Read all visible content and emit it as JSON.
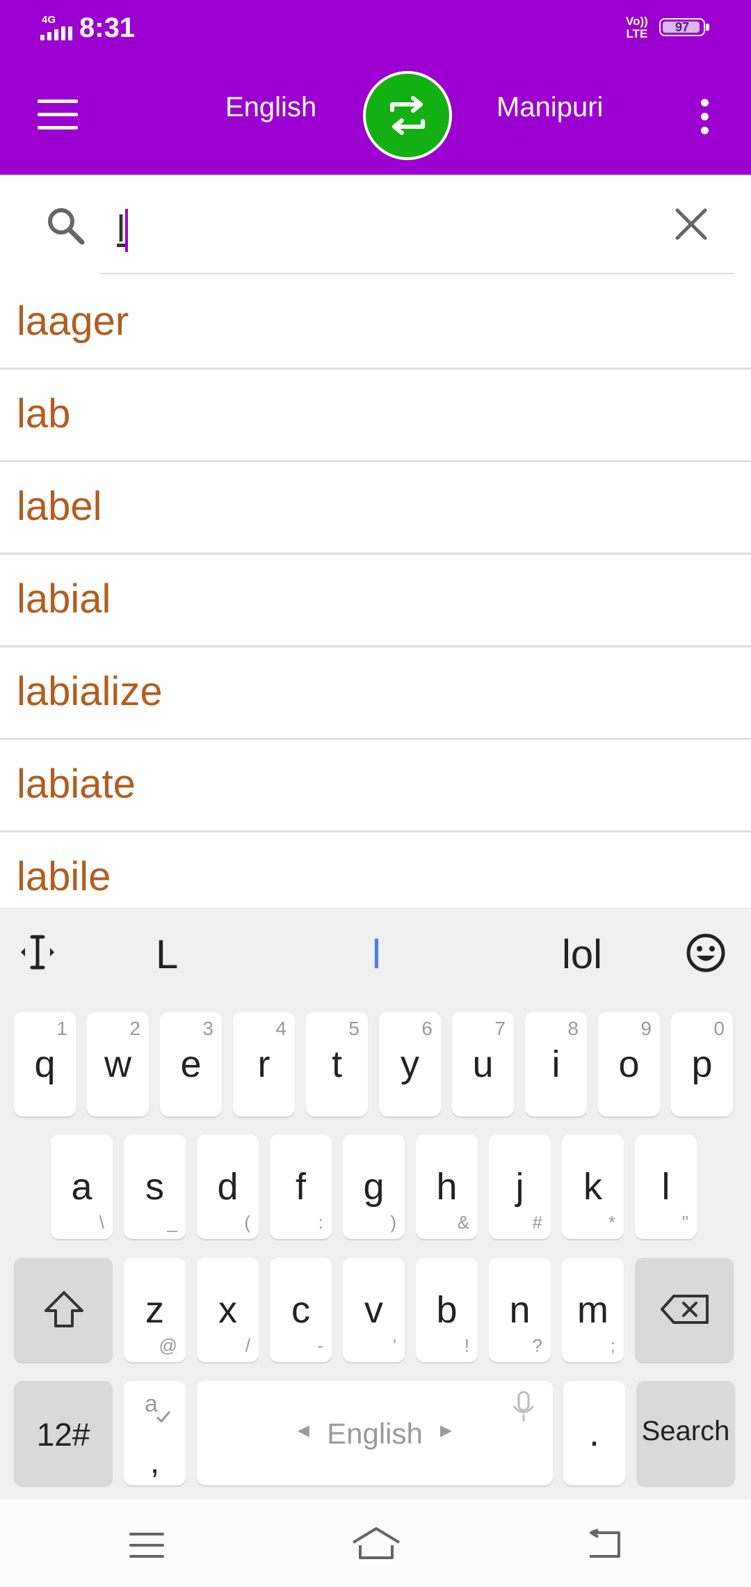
{
  "status_bar": {
    "network": "4G",
    "time": "8:31",
    "volte_top": "Vo))",
    "volte_bottom": "LTE",
    "battery": "97"
  },
  "app_bar": {
    "source_language": "English",
    "target_language": "Manipuri"
  },
  "search": {
    "value": "l"
  },
  "suggestions": [
    "laager",
    "lab",
    "label",
    "labial",
    "labialize",
    "labiate",
    "labile"
  ],
  "keyboard": {
    "suggestions": [
      "L",
      "l",
      "lol"
    ],
    "rows": [
      [
        {
          "k": "q",
          "hint": "1"
        },
        {
          "k": "w",
          "hint": "2"
        },
        {
          "k": "e",
          "hint": "3"
        },
        {
          "k": "r",
          "hint": "4"
        },
        {
          "k": "t",
          "hint": "5"
        },
        {
          "k": "y",
          "hint": "6"
        },
        {
          "k": "u",
          "hint": "7"
        },
        {
          "k": "i",
          "hint": "8"
        },
        {
          "k": "o",
          "hint": "9"
        },
        {
          "k": "p",
          "hint": "0"
        }
      ],
      [
        {
          "k": "a",
          "sub": "\\"
        },
        {
          "k": "s",
          "sub": "_"
        },
        {
          "k": "d",
          "sub": "("
        },
        {
          "k": "f",
          "sub": ":"
        },
        {
          "k": "g",
          "sub": ")"
        },
        {
          "k": "h",
          "sub": "&"
        },
        {
          "k": "j",
          "sub": "#"
        },
        {
          "k": "k",
          "sub": "*"
        },
        {
          "k": "l",
          "sub": "\""
        }
      ],
      [
        {
          "k": "z",
          "sub": "@"
        },
        {
          "k": "x",
          "sub": "/"
        },
        {
          "k": "c",
          "sub": "-"
        },
        {
          "k": "v",
          "sub": "'"
        },
        {
          "k": "b",
          "sub": "!"
        },
        {
          "k": "n",
          "sub": "?"
        },
        {
          "k": "m",
          "sub": ";"
        }
      ]
    ],
    "numbers_key": "12#",
    "comma_key": ",",
    "space_language": "English",
    "period_key": ".",
    "action_key": "Search"
  },
  "colors": {
    "app_bar": "#9b00d0",
    "swap_button": "#13b013",
    "suggestion_text": "#b25d1f"
  }
}
